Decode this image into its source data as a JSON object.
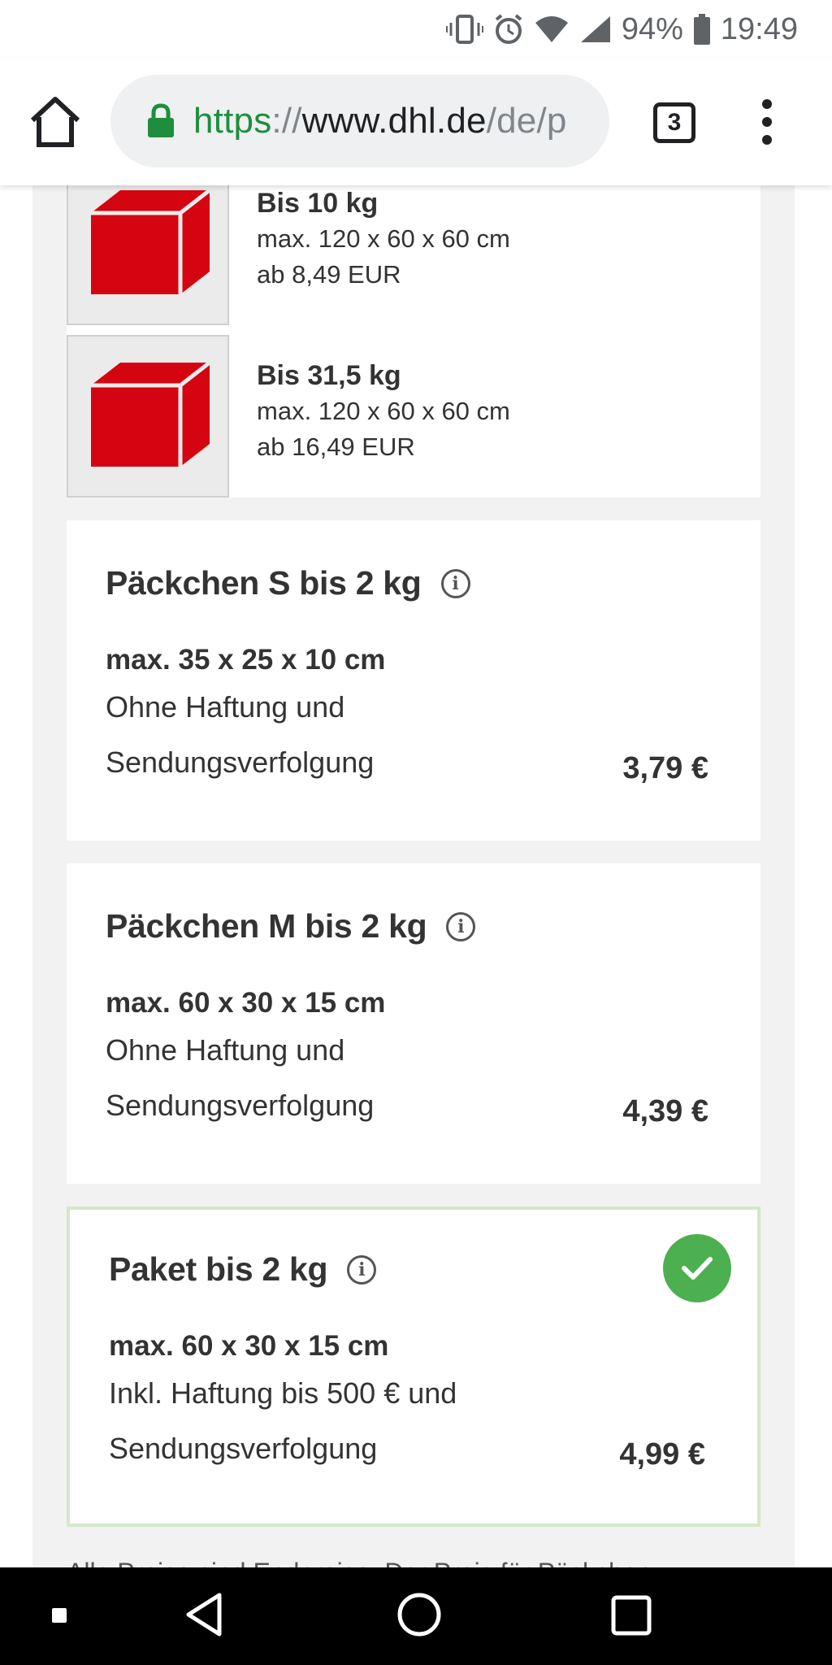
{
  "status_bar": {
    "battery": "94%",
    "time": "19:49"
  },
  "browser": {
    "url_scheme": "https",
    "url_sep": "://",
    "url_host": "www.dhl.de",
    "url_path": "/de/p",
    "tab_count": "3"
  },
  "shipping_options": [
    {
      "title": "Bis 10 kg",
      "dims": "max. 120 x 60 x 60 cm",
      "price": "ab 8,49 EUR"
    },
    {
      "title": "Bis 31,5 kg",
      "dims": "max. 120 x 60 x 60 cm",
      "price": "ab 16,49 EUR"
    }
  ],
  "cards": [
    {
      "title": "Päckchen S bis 2 kg",
      "dims": "max. 35 x 25 x 10 cm",
      "desc_line1": "Ohne Haftung und",
      "desc_line2": "Sendungsverfolgung",
      "price": "3,79 €",
      "selected": false
    },
    {
      "title": "Päckchen M bis 2 kg",
      "dims": "max. 60 x 30 x 15 cm",
      "desc_line1": "Ohne Haftung und",
      "desc_line2": "Sendungsverfolgung",
      "price": "4,39 €",
      "selected": false
    },
    {
      "title": "Paket bis 2 kg",
      "dims": "max. 60 x 30 x 15 cm",
      "desc_line1": "Inkl. Haftung bis 500 € und",
      "desc_line2": "Sendungsverfolgung",
      "price": "4,99 €",
      "selected": true
    }
  ],
  "info_glyph": "i",
  "footnote": "Alle Preise sind Endpreise. Der Preis für Päckchen",
  "colors": {
    "brand_red": "#d40511",
    "selected_green": "#4caf50",
    "selected_border": "#d4e8c8",
    "url_green": "#1e8e3e"
  },
  "icons": [
    "vibrate-icon",
    "alarm-icon",
    "wifi-icon",
    "signal-icon",
    "battery-icon",
    "home-icon",
    "lock-icon",
    "tabs-icon",
    "more-menu-icon",
    "package-icon",
    "info-icon",
    "check-icon",
    "back-icon",
    "home-circle-icon",
    "recents-icon"
  ]
}
